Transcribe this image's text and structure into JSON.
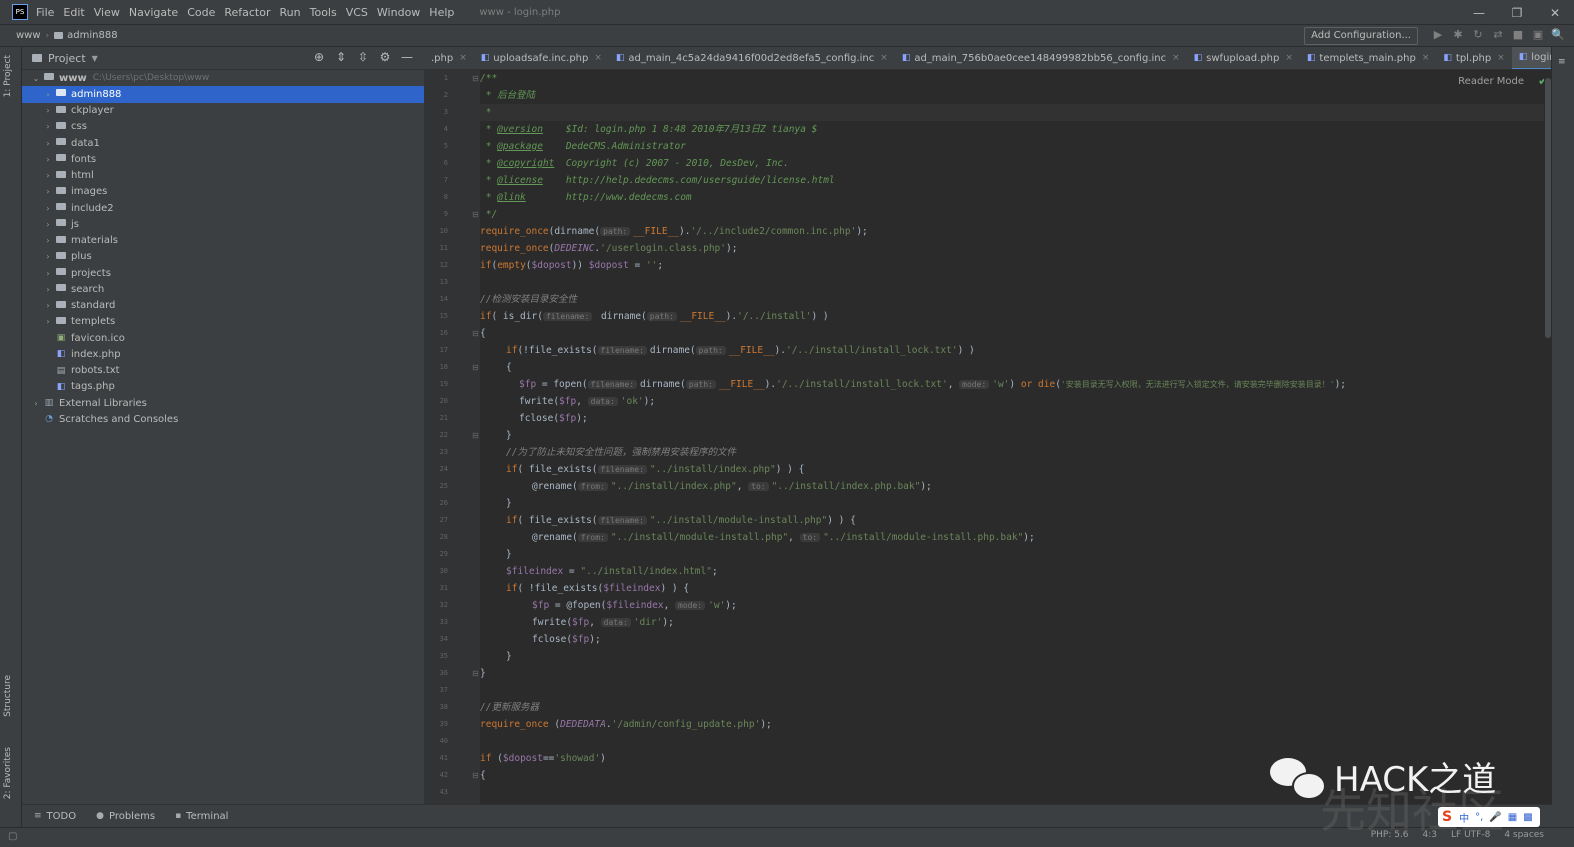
{
  "app": {
    "logo_text": "PS",
    "window_title": "www - login.php"
  },
  "menu": [
    "File",
    "Edit",
    "View",
    "Navigate",
    "Code",
    "Refactor",
    "Run",
    "Tools",
    "VCS",
    "Window",
    "Help"
  ],
  "window_controls": [
    "—",
    "❐",
    "✕"
  ],
  "breadcrumb": {
    "root": "www",
    "folder": "admin888"
  },
  "toolbar": {
    "add_config_label": "Add Configuration...",
    "icons": [
      "▶",
      "✱",
      "↻",
      "⇄",
      "■",
      "▣",
      "🔍"
    ]
  },
  "left_strip": {
    "project_tab": "1: Project",
    "structure_tab": "Structure",
    "favorites_tab": "2: Favorites"
  },
  "project_panel": {
    "title": "Project",
    "root": {
      "name": "www",
      "path": "C:\\Users\\pc\\Desktop\\www"
    },
    "items": [
      {
        "name": "admin888",
        "type": "folder",
        "selected": true
      },
      {
        "name": "ckplayer",
        "type": "folder"
      },
      {
        "name": "css",
        "type": "folder"
      },
      {
        "name": "data1",
        "type": "folder"
      },
      {
        "name": "fonts",
        "type": "folder"
      },
      {
        "name": "html",
        "type": "folder"
      },
      {
        "name": "images",
        "type": "folder"
      },
      {
        "name": "include2",
        "type": "folder"
      },
      {
        "name": "js",
        "type": "folder"
      },
      {
        "name": "materials",
        "type": "folder"
      },
      {
        "name": "plus",
        "type": "folder"
      },
      {
        "name": "projects",
        "type": "folder"
      },
      {
        "name": "search",
        "type": "folder"
      },
      {
        "name": "standard",
        "type": "folder"
      },
      {
        "name": "templets",
        "type": "folder"
      },
      {
        "name": "favicon.ico",
        "type": "file"
      },
      {
        "name": "index.php",
        "type": "php"
      },
      {
        "name": "robots.txt",
        "type": "file"
      },
      {
        "name": "tags.php",
        "type": "php"
      }
    ],
    "external_libraries": "External Libraries",
    "scratches": "Scratches and Consoles"
  },
  "tabs": [
    {
      "label": ".php",
      "partial": true
    },
    {
      "label": "uploadsafe.inc.php"
    },
    {
      "label": "ad_main_4c5a24da9416f00d2ed8efa5_config.inc"
    },
    {
      "label": "ad_main_756b0ae0cee148499982bb56_config.inc"
    },
    {
      "label": "swfupload.php"
    },
    {
      "label": "templets_main.php"
    },
    {
      "label": "tpl.php"
    },
    {
      "label": "login.php",
      "active": true
    }
  ],
  "reader_mode": "Reader Mode",
  "line_numbers": [
    "1",
    "2",
    "3",
    "4",
    "5",
    "6",
    "7",
    "8",
    "9",
    "10",
    "11",
    "12",
    "13",
    "14",
    "15",
    "16",
    "17",
    "18",
    "19",
    "20",
    "21",
    "22",
    "23",
    "24",
    "25",
    "26",
    "27",
    "28",
    "29",
    "30",
    "31",
    "32",
    "33",
    "34",
    "35",
    "36",
    "37",
    "38",
    "39",
    "40",
    "41",
    "42",
    "43"
  ],
  "code": {
    "l1": "/**",
    "l2": " * 后台登陆",
    "l3": " *",
    "l4_tag": "@version",
    "l4_txt": "    $Id: login.php 1 8:48 2010年7月13日Z tianya $",
    "l5_tag": "@package",
    "l5_txt": "    DedeCMS.Administrator",
    "l6_tag": "@copyright",
    "l6_txt": "  Copyright (c) 2007 - 2010, DesDev, Inc.",
    "l7_tag": "@license",
    "l7_txt": "    http://help.dedecms.com/usersguide/license.html",
    "l8_tag": "@link",
    "l8_txt": "       http://www.dedecms.com",
    "l9": " */",
    "l10_a": "require_once",
    "l10_b": "(dirname(",
    "l10_h": "path:",
    "l10_c": "__FILE__",
    "l10_d": ").",
    "l10_e": "'/../include2/common.inc.php'",
    "l10_f": ");",
    "l11_a": "require_once",
    "l11_b": "(",
    "l11_c": "DEDEINC",
    "l11_d": ".",
    "l11_e": "'/userlogin.class.php'",
    "l11_f": ");",
    "l12_a": "if",
    "l12_b": "(",
    "l12_c": "empty",
    "l12_d": "(",
    "l12_e": "$dopost",
    "l12_f": ")) ",
    "l12_g": "$dopost",
    "l12_h": " = ",
    "l12_i": "''",
    "l12_j": ";",
    "l14": "//检测安装目录安全性",
    "l15_a": "if",
    "l15_b": "( is_dir(",
    "l15_h1": "filename:",
    "l15_c": " dirname(",
    "l15_h2": "path:",
    "l15_d": "__FILE__",
    "l15_e": ").",
    "l15_f": "'/../install'",
    "l15_g": ") )",
    "l16": "{",
    "l17_a": "if",
    "l17_b": "(!file_exists(",
    "l17_h1": "filename:",
    "l17_c": "dirname(",
    "l17_h2": "path:",
    "l17_d": "__FILE__",
    "l17_e": ").",
    "l17_f": "'/../install/install_lock.txt'",
    "l17_g": ") )",
    "l18": "{",
    "l19_a": "$fp",
    "l19_b": " = fopen(",
    "l19_h1": "filename:",
    "l19_c": "dirname(",
    "l19_h2": "path:",
    "l19_d": "__FILE__",
    "l19_e": ").",
    "l19_f": "'/../install/install_lock.txt'",
    "l19_g": ", ",
    "l19_h3": "mode:",
    "l19_i": "'w'",
    "l19_j": ") ",
    "l19_k": "or die",
    "l19_l": "(",
    "l19_m": "'安装目录无写入权限，无法进行写入锁定文件，请安装完毕删除安装目录！'",
    "l19_n": ");",
    "l20_a": "fwrite(",
    "l20_b": "$fp",
    "l20_c": ", ",
    "l20_h": "data:",
    "l20_d": "'ok'",
    "l20_e": ");",
    "l21_a": "fclose(",
    "l21_b": "$fp",
    "l21_c": ");",
    "l22": "}",
    "l23": "//为了防止未知安全性问题，强制禁用安装程序的文件",
    "l24_a": "if",
    "l24_b": "( file_exists(",
    "l24_h": "filename:",
    "l24_c": "\"../install/index.php\"",
    "l24_d": ") ) {",
    "l25_a": "@rename(",
    "l25_h1": "from:",
    "l25_b": "\"../install/index.php\"",
    "l25_c": ", ",
    "l25_h2": "to:",
    "l25_d": "\"../install/index.php.bak\"",
    "l25_e": ");",
    "l26": "}",
    "l27_a": "if",
    "l27_b": "( file_exists(",
    "l27_h": "filename:",
    "l27_c": "\"../install/module-install.php\"",
    "l27_d": ") ) {",
    "l28_a": "@rename(",
    "l28_h1": "from:",
    "l28_b": "\"../install/module-install.php\"",
    "l28_c": ", ",
    "l28_h2": "to:",
    "l28_d": "\"../install/module-install.php.bak\"",
    "l28_e": ");",
    "l29": "}",
    "l30_a": "$fileindex",
    "l30_b": " = ",
    "l30_c": "\"../install/index.html\"",
    "l30_d": ";",
    "l31_a": "if",
    "l31_b": "( !file_exists(",
    "l31_c": "$fileindex",
    "l31_d": ") ) {",
    "l32_a": "$fp",
    "l32_b": " = @fopen(",
    "l32_c": "$fileindex",
    "l32_d": ", ",
    "l32_h": "mode:",
    "l32_e": "'w'",
    "l32_f": ");",
    "l33_a": "fwrite(",
    "l33_b": "$fp",
    "l33_c": ", ",
    "l33_h": "data:",
    "l33_d": "'dir'",
    "l33_e": ");",
    "l34_a": "fclose(",
    "l34_b": "$fp",
    "l34_c": ");",
    "l35": "}",
    "l36": "}",
    "l38": "//更新服务器",
    "l39_a": "require_once",
    "l39_b": " (",
    "l39_c": "DEDEDATA",
    "l39_d": ".",
    "l39_e": "'/admin/config_update.php'",
    "l39_f": ");",
    "l41_a": "if",
    "l41_b": " (",
    "l41_c": "$dopost",
    "l41_d": "==",
    "l41_e": "'showad'",
    "l41_f": ")",
    "l42": "{"
  },
  "bottom_tools": [
    {
      "icon": "≡",
      "label": "TODO"
    },
    {
      "icon": "●",
      "label": "Problems"
    },
    {
      "icon": "▪",
      "label": "Terminal"
    }
  ],
  "status": {
    "php": "PHP: 5.6",
    "pos": "4:3",
    "encoding": "LF  UTF-8",
    "indent": "4 spaces"
  },
  "watermark": {
    "text": "HACK之道",
    "faded": "先知社区"
  },
  "ime": {
    "logo": "S",
    "items": [
      "中",
      "°,",
      "🎤",
      "▦",
      "▩"
    ]
  }
}
